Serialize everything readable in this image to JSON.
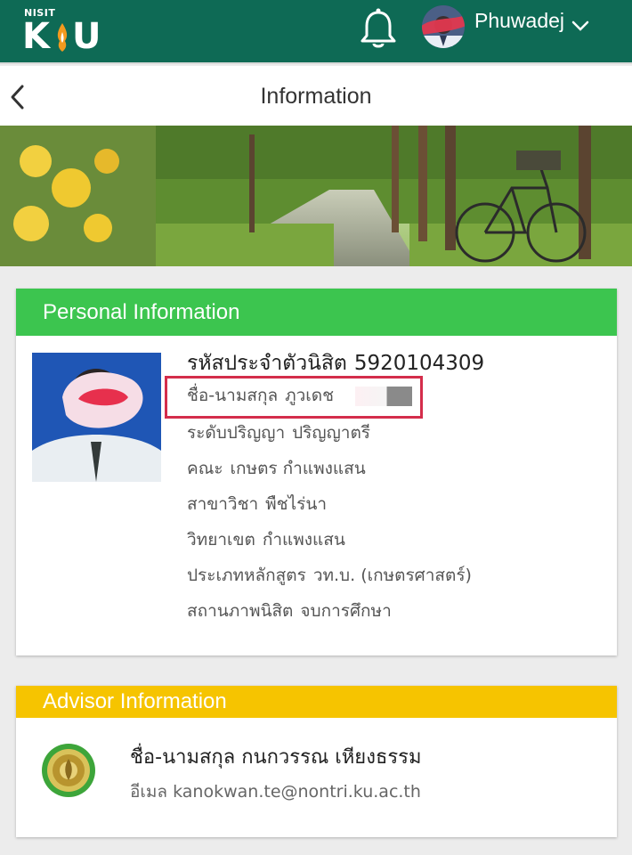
{
  "app": {
    "logo_small": "NISIT",
    "logo_k": "K",
    "logo_u": "U",
    "username": "Phuwadej",
    "brand_color": "#0e6a55"
  },
  "page": {
    "title": "Information"
  },
  "personal": {
    "header": "Personal Information",
    "student_id_label": "รหัสประจำตัวนิสิต",
    "student_id": "5920104309",
    "name_label": "ชื่อ-นามสกุล",
    "name": "ภูวเดช",
    "degree_label": "ระดับปริญญา",
    "degree": "ปริญญาตรี",
    "faculty_label": "คณะ",
    "faculty": "เกษตร กำแพงแสน",
    "major_label": "สาขาวิชา",
    "major": "พืชไร่นา",
    "campus_label": "วิทยาเขต",
    "campus": "กำแพงแสน",
    "program_label": "ประเภทหลักสูตร",
    "program": "วท.บ. (เกษตรศาสตร์)",
    "status_label": "สถานภาพนิสิต",
    "status": "จบการศึกษา",
    "header_color": "#3cc54f"
  },
  "advisor": {
    "header": "Advisor Information",
    "name_label": "ชื่อ-นามสกุล",
    "name": "กนกวรรณ เหียงธรรม",
    "email_label": "อีเมล",
    "email": "kanokwan.te@nontri.ku.ac.th",
    "header_color": "#f6c400"
  },
  "icons": {
    "logo": "ku-logo-icon",
    "bell": "bell-icon",
    "avatar": "user-avatar",
    "chevron": "chevron-down-icon",
    "back": "back-arrow-icon",
    "seal": "university-seal-icon"
  }
}
